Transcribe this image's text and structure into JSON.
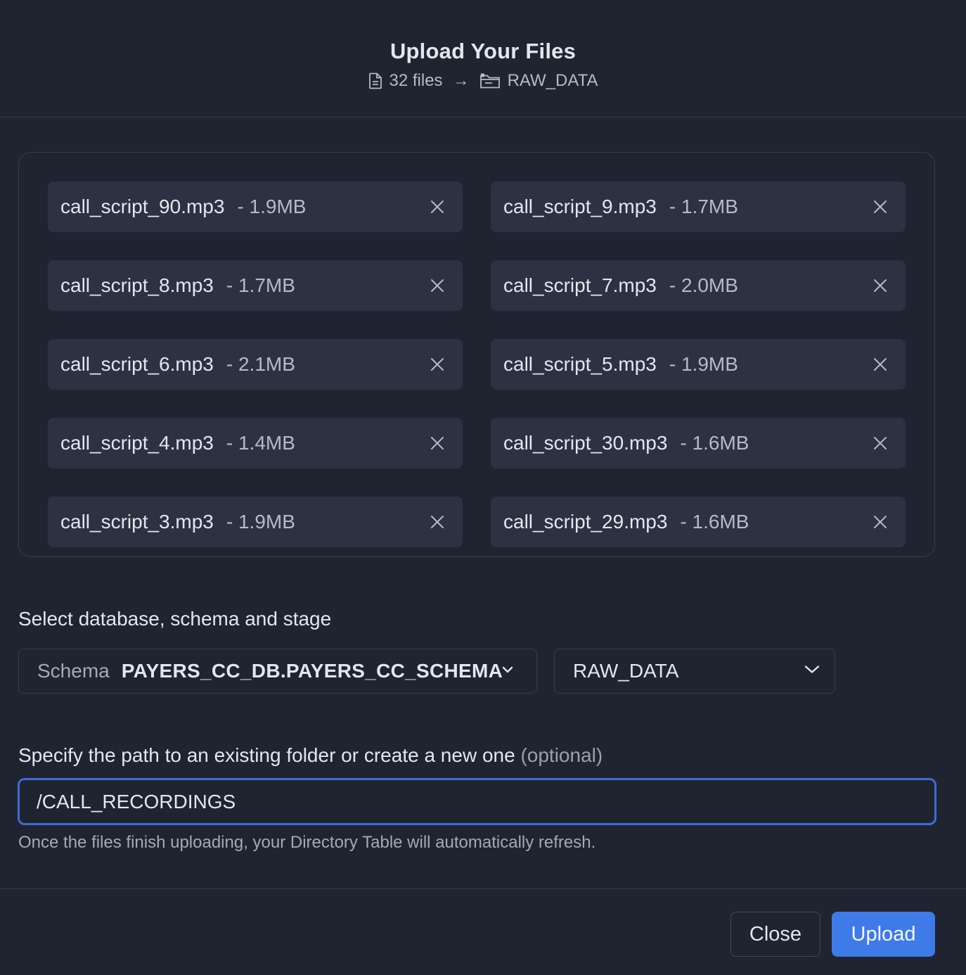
{
  "header": {
    "title": "Upload Your Files",
    "file_count": "32 files",
    "arrow": "→",
    "destination": "RAW_DATA"
  },
  "files": [
    {
      "name": "call_script_90.mp3",
      "size": "- 1.9MB"
    },
    {
      "name": "call_script_9.mp3",
      "size": "- 1.7MB"
    },
    {
      "name": "call_script_8.mp3",
      "size": "- 1.7MB"
    },
    {
      "name": "call_script_7.mp3",
      "size": "- 2.0MB"
    },
    {
      "name": "call_script_6.mp3",
      "size": "- 2.1MB"
    },
    {
      "name": "call_script_5.mp3",
      "size": "- 1.9MB"
    },
    {
      "name": "call_script_4.mp3",
      "size": "- 1.4MB"
    },
    {
      "name": "call_script_30.mp3",
      "size": "- 1.6MB"
    },
    {
      "name": "call_script_3.mp3",
      "size": "- 1.9MB"
    },
    {
      "name": "call_script_29.mp3",
      "size": "- 1.6MB"
    }
  ],
  "location": {
    "label": "Select database, schema and stage",
    "schema_prefix": "Schema",
    "schema_value": "PAYERS_CC_DB.PAYERS_CC_SCHEMA",
    "stage_value": "RAW_DATA"
  },
  "path": {
    "label": "Specify the path to an existing folder or create a new one",
    "optional_label": "(optional)",
    "value": "/CALL_RECORDINGS",
    "helper": "Once the files finish uploading, your Directory Table will automatically refresh."
  },
  "footer": {
    "close_label": "Close",
    "upload_label": "Upload"
  },
  "colors": {
    "background": "#1f2430",
    "chip": "#2c3241",
    "accent": "#3f7ae9",
    "focus_border": "#3b6dd6"
  }
}
